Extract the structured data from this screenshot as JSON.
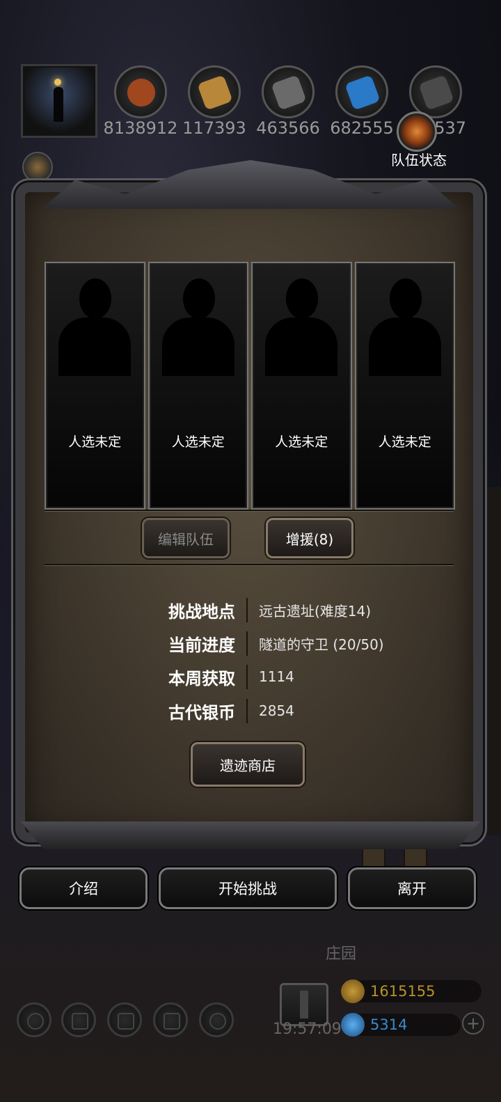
{
  "resources": {
    "r1": "8138912",
    "r2": "117393",
    "r3": "463566",
    "r4": "682555",
    "r5": "537"
  },
  "team_status_label": "队伍状态",
  "slots": [
    "人选未定",
    "人选未定",
    "人选未定",
    "人选未定"
  ],
  "buttons": {
    "edit_team": "编辑队伍",
    "reinforce": "增援(8)",
    "shop": "遗迹商店",
    "intro": "介绍",
    "start": "开始挑战",
    "leave": "离开"
  },
  "info": {
    "location_key": "挑战地点",
    "location_val": "远古遗址(难度14)",
    "progress_key": "当前进度",
    "progress_val": "隧道的守卫 (20/50)",
    "weekly_key": "本周获取",
    "weekly_val": "1114",
    "coins_key": "古代银币",
    "coins_val": "2854"
  },
  "hud": {
    "manor": "庄园",
    "timer": "19:57:09",
    "gold": "1615155",
    "gems": "5314",
    "plus": "+"
  },
  "colors": {
    "gold_text": "#b8922a",
    "gem_text": "#3a8ad0",
    "panel_border": "#3a3a3e"
  }
}
